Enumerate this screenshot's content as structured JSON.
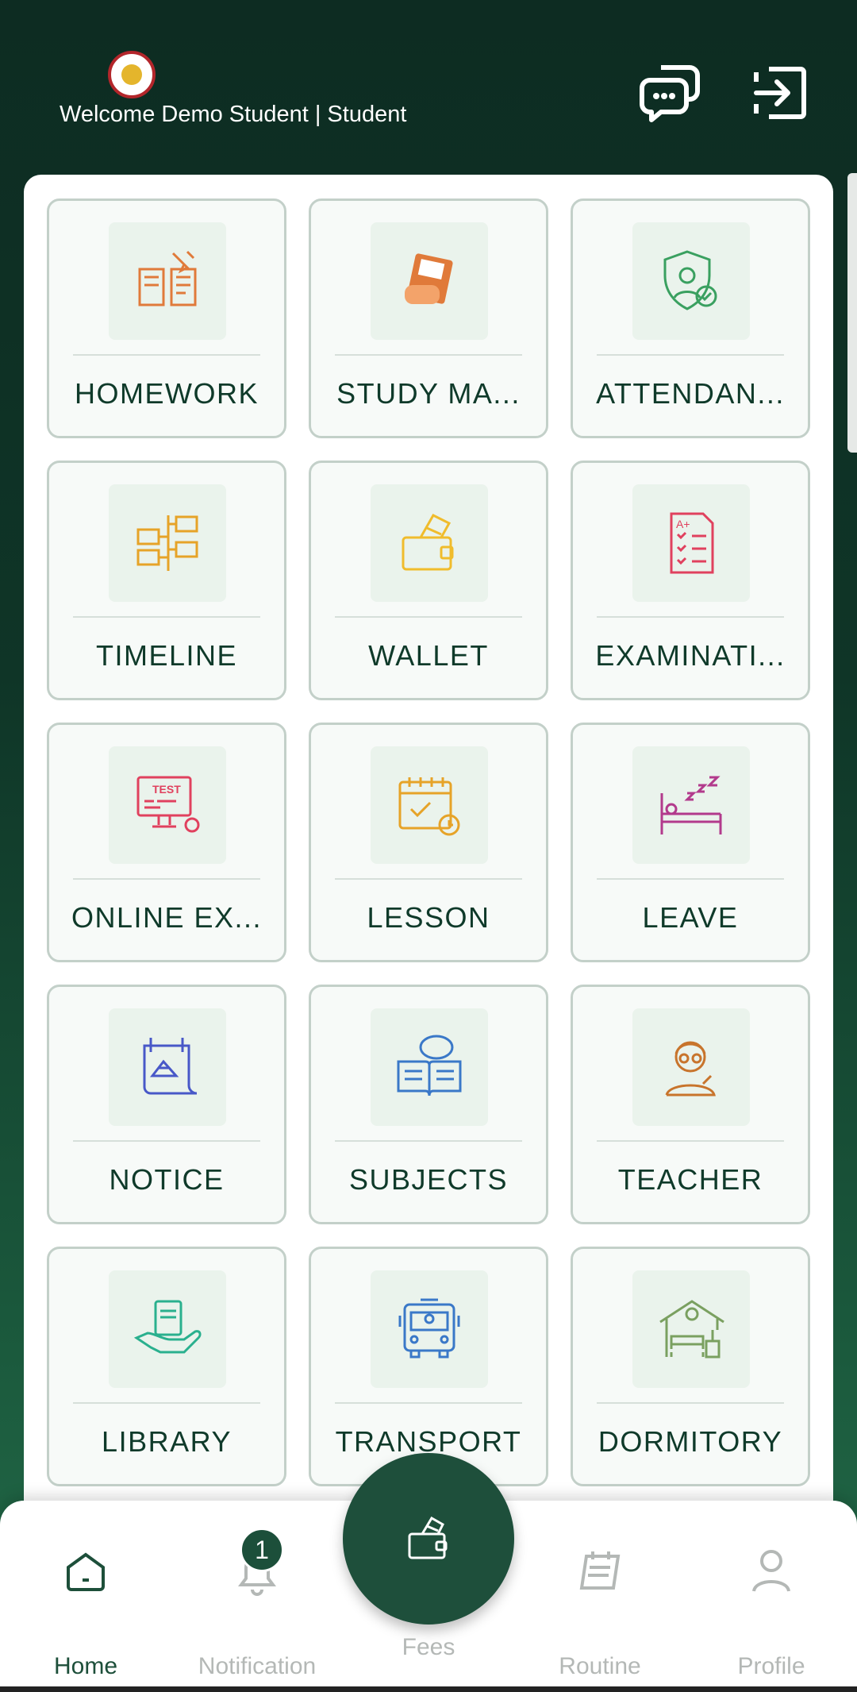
{
  "header": {
    "welcome_text": "Welcome Demo Student | Student",
    "chat_icon": "chat-bubbles-icon",
    "logout_icon": "logout-icon"
  },
  "tiles": [
    {
      "label": "HOMEWORK",
      "icon": "homework-icon",
      "color": "#e07a3a"
    },
    {
      "label": "STUDY MA...",
      "icon": "study-material-icon",
      "color": "#e07a3a"
    },
    {
      "label": "ATTENDAN...",
      "icon": "attendance-icon",
      "color": "#3aa060"
    },
    {
      "label": "TIMELINE",
      "icon": "timeline-icon",
      "color": "#e6a328"
    },
    {
      "label": "WALLET",
      "icon": "wallet-icon",
      "color": "#f0bc2c"
    },
    {
      "label": "EXAMINATI...",
      "icon": "examination-icon",
      "color": "#e0415e"
    },
    {
      "label": "ONLINE EX...",
      "icon": "online-exam-icon",
      "color": "#e0415e"
    },
    {
      "label": "LESSON",
      "icon": "lesson-icon",
      "color": "#e6a328"
    },
    {
      "label": "LEAVE",
      "icon": "leave-icon",
      "color": "#b23a8c"
    },
    {
      "label": "NOTICE",
      "icon": "notice-icon",
      "color": "#4858c8"
    },
    {
      "label": "SUBJECTS",
      "icon": "subjects-icon",
      "color": "#3a78c8"
    },
    {
      "label": "TEACHER",
      "icon": "teacher-icon",
      "color": "#c8742c"
    },
    {
      "label": "LIBRARY",
      "icon": "library-icon",
      "color": "#2ab08e"
    },
    {
      "label": "TRANSPORT",
      "icon": "transport-icon",
      "color": "#3a78c8"
    },
    {
      "label": "DORMITORY",
      "icon": "dormitory-icon",
      "color": "#7aa060"
    }
  ],
  "nav": {
    "home": "Home",
    "notification": "Notification",
    "notification_count": "1",
    "fees": "Fees",
    "routine": "Routine",
    "profile": "Profile"
  },
  "colors": {
    "primary": "#1e4f3b",
    "header_bg": "#0d2c22",
    "tile_border": "#c3d0c9",
    "nav_inactive": "#b4b8b6"
  }
}
